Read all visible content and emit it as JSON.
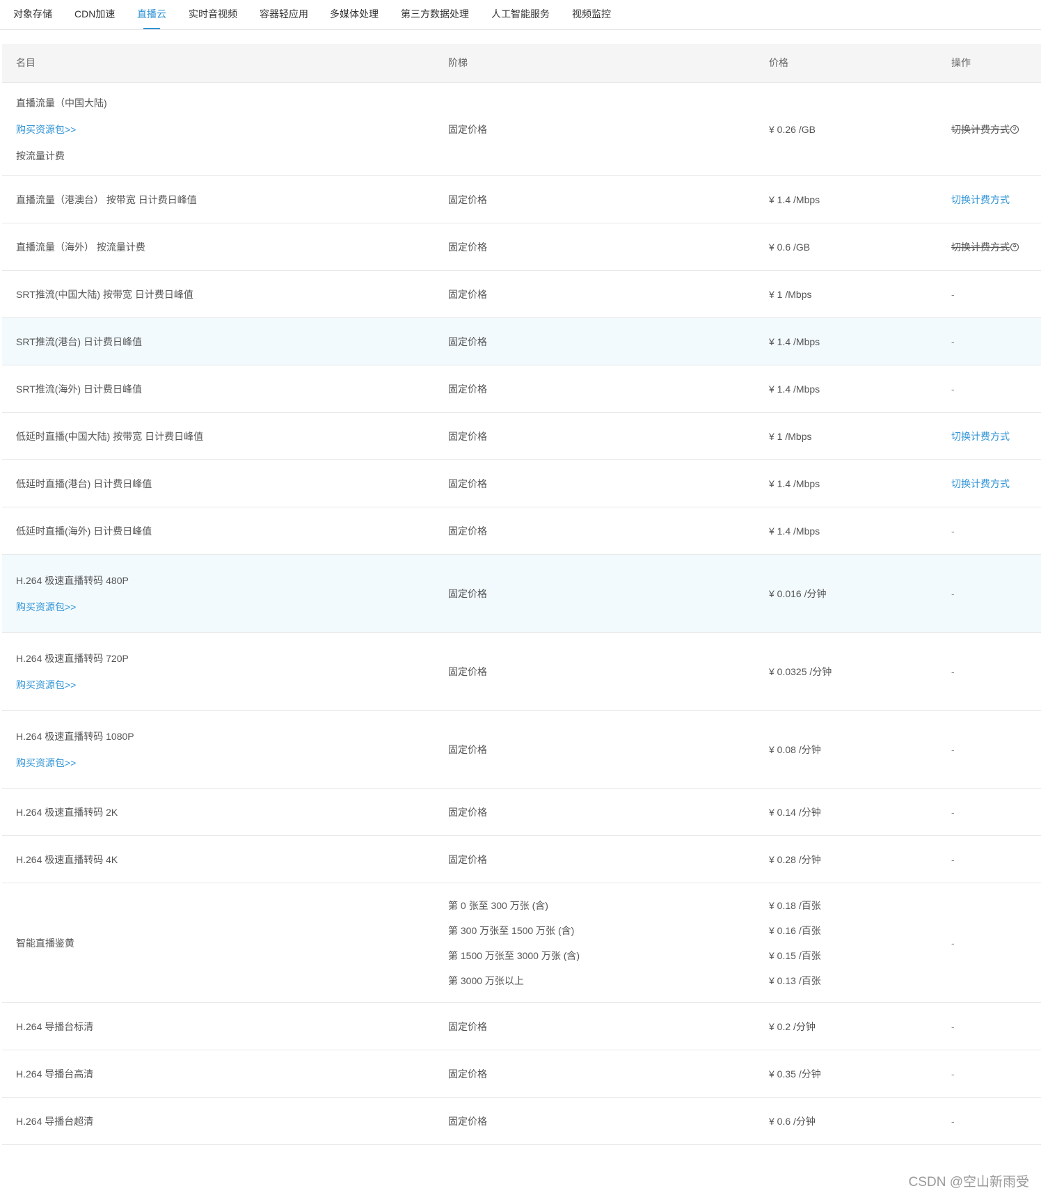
{
  "tabs": [
    {
      "label": "对象存储",
      "active": false
    },
    {
      "label": "CDN加速",
      "active": false
    },
    {
      "label": "直播云",
      "active": true
    },
    {
      "label": "实时音视频",
      "active": false
    },
    {
      "label": "容器轻应用",
      "active": false
    },
    {
      "label": "多媒体处理",
      "active": false
    },
    {
      "label": "第三方数据处理",
      "active": false
    },
    {
      "label": "人工智能服务",
      "active": false
    },
    {
      "label": "视频监控",
      "active": false
    }
  ],
  "table": {
    "headers": {
      "name": "名目",
      "tier": "阶梯",
      "price": "价格",
      "op": "操作"
    },
    "rows": [
      {
        "name": "直播流量（中国大陆)",
        "link": "购买资源包>>",
        "sub": "按流量计费",
        "tier": "固定价格",
        "price": "¥ 0.26 /GB",
        "op": "切换计费方式",
        "help": "?"
      },
      {
        "name": "直播流量（港澳台） 按带宽 日计费日峰值",
        "tier": "固定价格",
        "price": "¥ 1.4 /Mbps",
        "op": "切换计费方式"
      },
      {
        "name": "直播流量（海外） 按流量计费",
        "tier": "固定价格",
        "price": "¥ 0.6 /GB",
        "op": "切换计费方式",
        "help": "?"
      },
      {
        "name": "SRT推流(中国大陆) 按带宽 日计费日峰值",
        "tier": "固定价格",
        "price": "¥ 1 /Mbps",
        "op": "-"
      },
      {
        "name": "SRT推流(港台) 日计费日峰值",
        "tier": "固定价格",
        "price": "¥ 1.4 /Mbps",
        "op": "-"
      },
      {
        "name": "SRT推流(海外) 日计费日峰值",
        "tier": "固定价格",
        "price": "¥ 1.4 /Mbps",
        "op": "-"
      },
      {
        "name": "低延时直播(中国大陆) 按带宽 日计费日峰值",
        "tier": "固定价格",
        "price": "¥ 1 /Mbps",
        "op": "切换计费方式"
      },
      {
        "name": "低延时直播(港台) 日计费日峰值",
        "tier": "固定价格",
        "price": "¥ 1.4 /Mbps",
        "op": "切换计费方式"
      },
      {
        "name": "低延时直播(海外) 日计费日峰值",
        "tier": "固定价格",
        "price": "¥ 1.4 /Mbps",
        "op": "-"
      },
      {
        "name": "H.264 极速直播转码 480P",
        "link": "购买资源包>>",
        "tier": "固定价格",
        "price": "¥ 0.016 /分钟",
        "op": "-"
      },
      {
        "name": "H.264 极速直播转码 720P",
        "link": "购买资源包>>",
        "tier": "固定价格",
        "price": "¥ 0.0325 /分钟",
        "op": "-"
      },
      {
        "name": "H.264 极速直播转码 1080P",
        "link": "购买资源包>>",
        "tier": "固定价格",
        "price": "¥ 0.08 /分钟",
        "op": "-"
      },
      {
        "name": "H.264 极速直播转码 2K",
        "tier": "固定价格",
        "price": "¥ 0.14 /分钟",
        "op": "-"
      },
      {
        "name": "H.264 极速直播转码 4K",
        "tier": "固定价格",
        "price": "¥ 0.28 /分钟",
        "op": "-"
      },
      {
        "name": "智能直播鉴黄",
        "tiers": [
          "第 0 张至 300 万张 (含)",
          "第 300 万张至 1500 万张 (含)",
          "第 1500 万张至 3000 万张 (含)",
          "第 3000 万张以上"
        ],
        "prices": [
          "¥ 0.18 /百张",
          "¥ 0.16 /百张",
          "¥ 0.15 /百张",
          "¥ 0.13 /百张"
        ],
        "op": "-"
      },
      {
        "name": "H.264 导播台标清",
        "tier": "固定价格",
        "price": "¥ 0.2 /分钟",
        "op": "-"
      },
      {
        "name": "H.264 导播台高清",
        "tier": "固定价格",
        "price": "¥ 0.35 /分钟",
        "op": "-"
      },
      {
        "name": "H.264 导播台超清",
        "tier": "固定价格",
        "price": "¥ 0.6 /分钟",
        "op": "-"
      }
    ]
  },
  "watermark": "CSDN @空山新雨受"
}
